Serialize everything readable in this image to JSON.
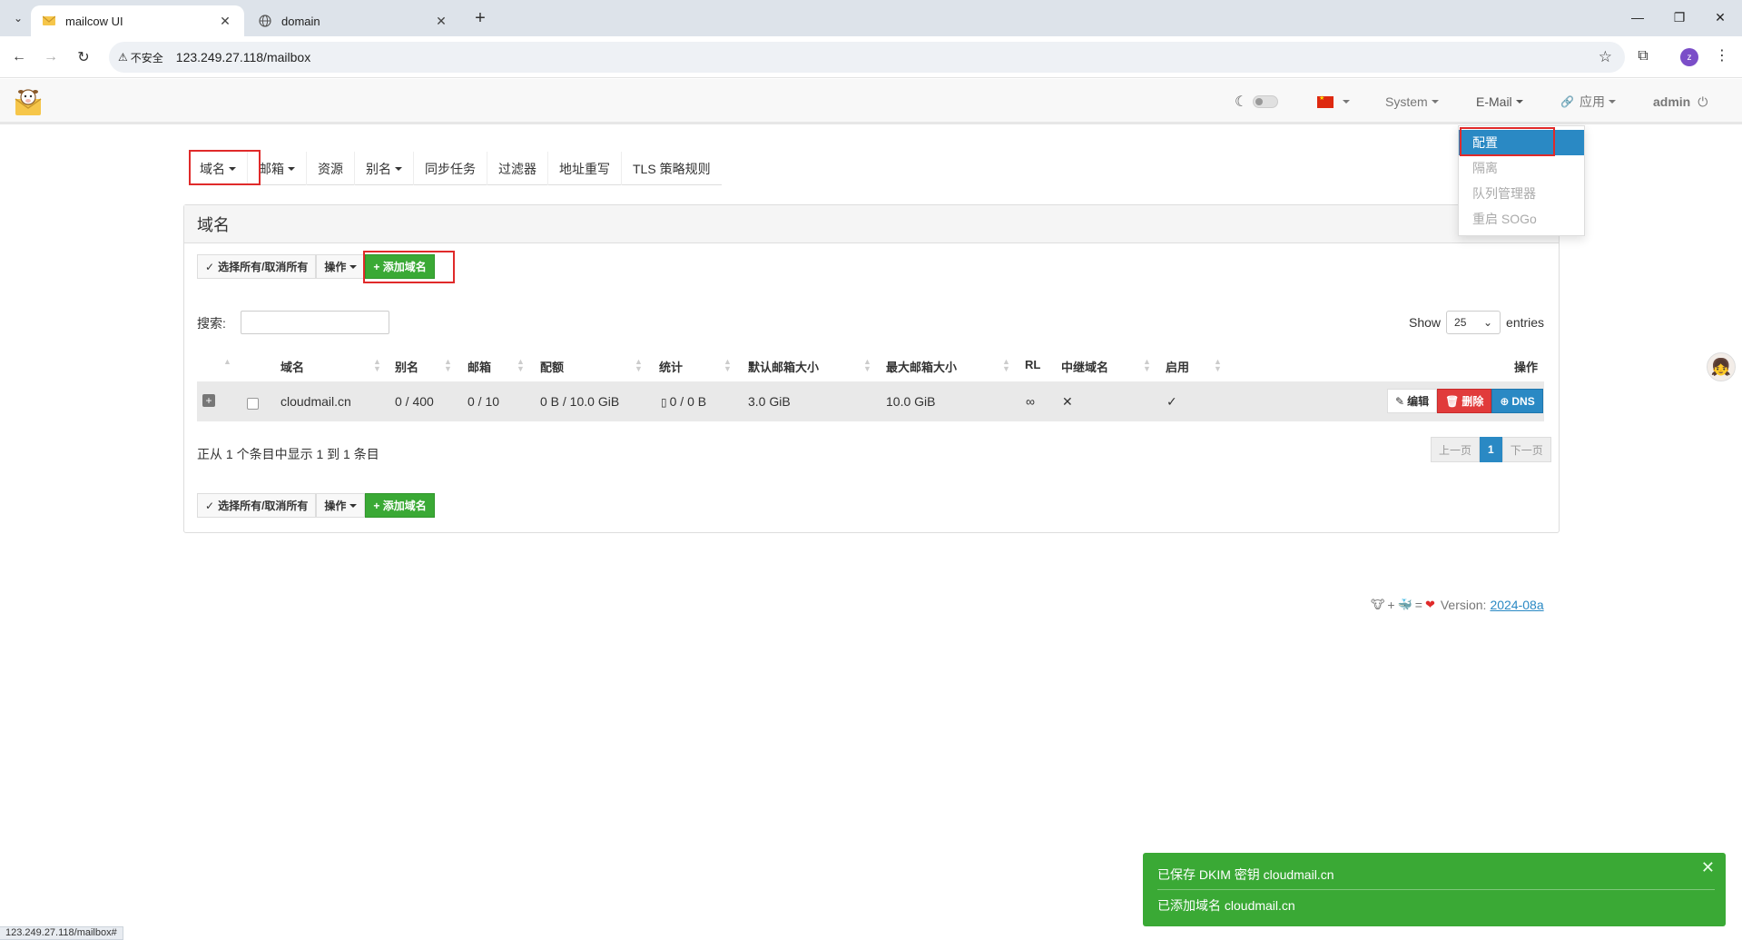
{
  "browser": {
    "tabs": [
      {
        "title": "mailcow UI",
        "active": true
      },
      {
        "title": "domain",
        "active": false
      }
    ],
    "insecure_label": "不安全",
    "url": "123.249.27.118/mailbox",
    "profile_initial": "z",
    "status_url": "123.249.27.118/mailbox#"
  },
  "navbar": {
    "system_label": "System",
    "email_label": "E-Mail",
    "apps_label": "应用",
    "user_label": "admin"
  },
  "email_menu": {
    "items": [
      "配置",
      "隔离",
      "队列管理器",
      "重启 SOGo"
    ]
  },
  "subtabs": [
    "域名",
    "邮箱",
    "资源",
    "别名",
    "同步任务",
    "过滤器",
    "地址重写",
    "TLS 策略规则"
  ],
  "panel": {
    "title": "域名",
    "select_all_label": "选择所有/取消所有",
    "actions_label": "操作",
    "add_domain_label": "+ 添加域名",
    "search_label": "搜索:",
    "show_label": "Show",
    "page_size": "25",
    "entries_label": "entries",
    "columns": [
      "域名",
      "别名",
      "邮箱",
      "配额",
      "统计",
      "默认邮箱大小",
      "最大邮箱大小",
      "RL",
      "中继域名",
      "启用",
      "操作"
    ],
    "rows": [
      {
        "domain": "cloudmail.cn",
        "aliases": "0 / 400",
        "mailboxes": "0 / 10",
        "quota": "0 B / 10.0 GiB",
        "stats": "0 / 0 B",
        "default_size": "3.0 GiB",
        "max_size": "10.0 GiB",
        "rl": "∞",
        "relay": "✕",
        "active": "✓",
        "edit_label": "编辑",
        "delete_label": "删除",
        "dns_label": "DNS"
      }
    ],
    "info": "正从 1 个条目中显示 1 到 1 条目",
    "pager": {
      "prev": "上一页",
      "current": "1",
      "next": "下一页"
    }
  },
  "footer": {
    "version_label": "Version:",
    "version": "2024-08a"
  },
  "toast": {
    "line1": "已保存 DKIM 密钥 cloudmail.cn",
    "line2": "已添加域名 cloudmail.cn"
  }
}
